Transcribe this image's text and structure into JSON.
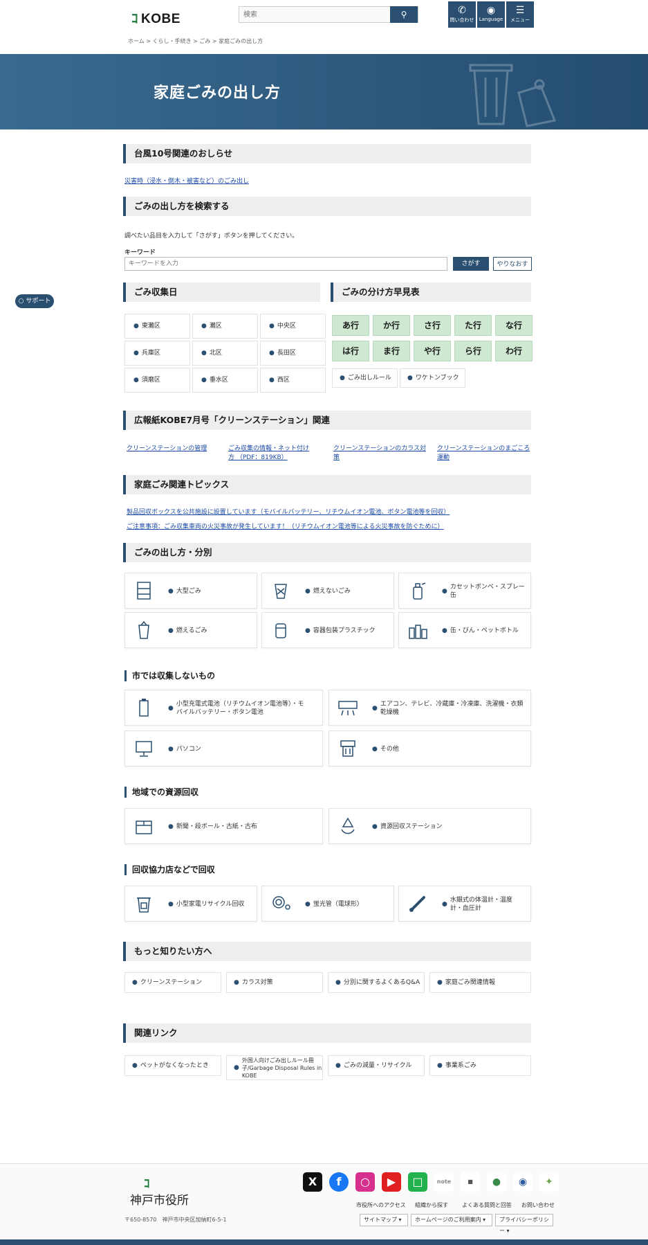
{
  "header": {
    "logo": "KOBE",
    "logo_mark": "ｺ",
    "search_placeholder": "検索",
    "btn_contact": "問い合わせ",
    "btn_language": "Language",
    "btn_menu": "メニュー"
  },
  "breadcrumb": "ホーム > くらし・手続き > ごみ > 家庭ごみの出し方",
  "hero": {
    "title": "家庭ごみの出し方"
  },
  "side_button": "サポート",
  "typhoon": {
    "heading": "台風10号関連のおしらせ",
    "link": "災害時（浸水・倒木・被害など）のごみ出し"
  },
  "search": {
    "heading": "ごみの出し方を検索する",
    "desc": "調べたい品目を入力して「さがす」ボタンを押してください。",
    "label": "キーワード",
    "placeholder": "キーワードを入力",
    "submit": "さがす",
    "reset": "やりなおす"
  },
  "collection": {
    "heading": "ごみ収集日",
    "days": [
      "東灘区",
      "灘区",
      "中央区",
      "兵庫区",
      "北区",
      "長田区",
      "須磨区",
      "垂水区",
      "西区"
    ]
  },
  "sorting": {
    "heading": "ごみの分け方早見表",
    "kana": [
      "あ行",
      "か行",
      "さ行",
      "た行",
      "な行",
      "は行",
      "ま行",
      "や行",
      "ら行",
      "わ行"
    ],
    "extra": [
      "ごみ出しルール",
      "ワケトンブック"
    ]
  },
  "kobe_paper": {
    "heading": "広報紙KOBE7月号「クリーンステーション」関連",
    "links": [
      "クリーンステーションの管理",
      "ごみ収集の情報・ネット付け方 （PDF：819KB）",
      "クリーンステーションのカラス対策",
      "クリーンステーションのまごころ運動"
    ]
  },
  "topics": {
    "heading": "家庭ごみ関連トピックス",
    "links": [
      "製品回収ボックスを公共施設に設置しています（モバイルバッテリー、リチウムイオン電池、ボタン電池等を回収）",
      "ご注意事項：ごみ収集車両の火災事故が発生しています！（リチウムイオン電池等による火災事故を防ぐために）"
    ]
  },
  "categories": {
    "heading": "ごみの出し方・分別",
    "items": [
      "大型ごみ",
      "燃えないごみ",
      "カセットボンベ・スプレー缶",
      "燃えるごみ",
      "容器包装プラスチック",
      "缶・びん・ペットボトル"
    ]
  },
  "not_collected": {
    "heading": "市では収集しないもの",
    "items": [
      "小型充電式電池（リチウムイオン電池等）・モバイルバッテリー・ボタン電池",
      "エアコン、テレビ、冷蔵庫・冷凍庫、洗濯機・衣類乾燥機",
      "パソコン",
      "その他"
    ]
  },
  "community": {
    "heading": "地域での資源回収",
    "items": [
      "新聞・段ボール・古紙・古布",
      "資源回収ステーション"
    ]
  },
  "stores": {
    "heading": "回収協力店などで回収",
    "items": [
      "小型家電リサイクル回収",
      "蛍光管（電球形）",
      "水銀式の体温計・温度計・血圧計"
    ]
  },
  "more": {
    "heading": "もっと知りたい方へ",
    "items": [
      "クリーンステーション",
      "カラス対策",
      "分別に関するよくあるQ&A",
      "家庭ごみ関連情報"
    ]
  },
  "related": {
    "heading": "関連リンク",
    "items": [
      "ペットがなくなったとき",
      "外国人向けごみ出しルール冊子/Garbage Disposal Rules in KOBE",
      "ごみの減量・リサイクル",
      "事業系ごみ"
    ]
  },
  "footer": {
    "org": "神戸市役所",
    "mark": "ｺ",
    "address": "〒650-8570　神戸市中央区加納町6-5-1",
    "links": [
      "市役所へのアクセス",
      "組織から探す",
      "よくある質問と回答",
      "お問い合わせ"
    ],
    "selects": [
      "サイトマップ",
      "ホームページのご利用案内",
      "プライバシーポリシー"
    ]
  }
}
